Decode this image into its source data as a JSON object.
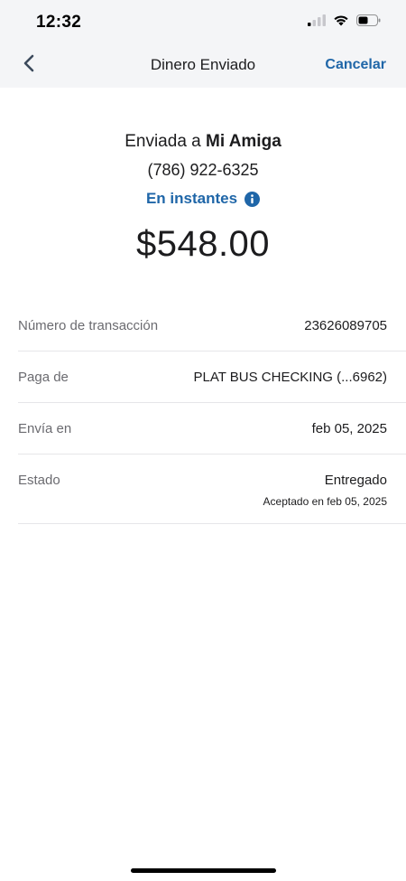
{
  "status_bar": {
    "time": "12:32"
  },
  "nav": {
    "title": "Dinero Enviado",
    "cancel_label": "Cancelar",
    "back_icon": "chevron-left-icon"
  },
  "summary": {
    "sent_prefix": "Enviada a",
    "recipient": "Mi Amiga",
    "phone": "(786) 922-6325",
    "speed": "En instantes",
    "amount": "$548.00"
  },
  "details": [
    {
      "label": "Número de transacción",
      "value": "23626089705"
    },
    {
      "label": "Paga de",
      "value": "PLAT BUS CHECKING (...6962)"
    },
    {
      "label": "Envía en",
      "value": "feb 05, 2025"
    },
    {
      "label": "Estado",
      "value": "Entregado",
      "subvalue": "Aceptado en feb 05, 2025"
    }
  ],
  "colors": {
    "accent": "#1f66a8",
    "header_bg": "#f4f5f7",
    "label_gray": "#6b6b70",
    "divider": "#e6e6e9"
  }
}
